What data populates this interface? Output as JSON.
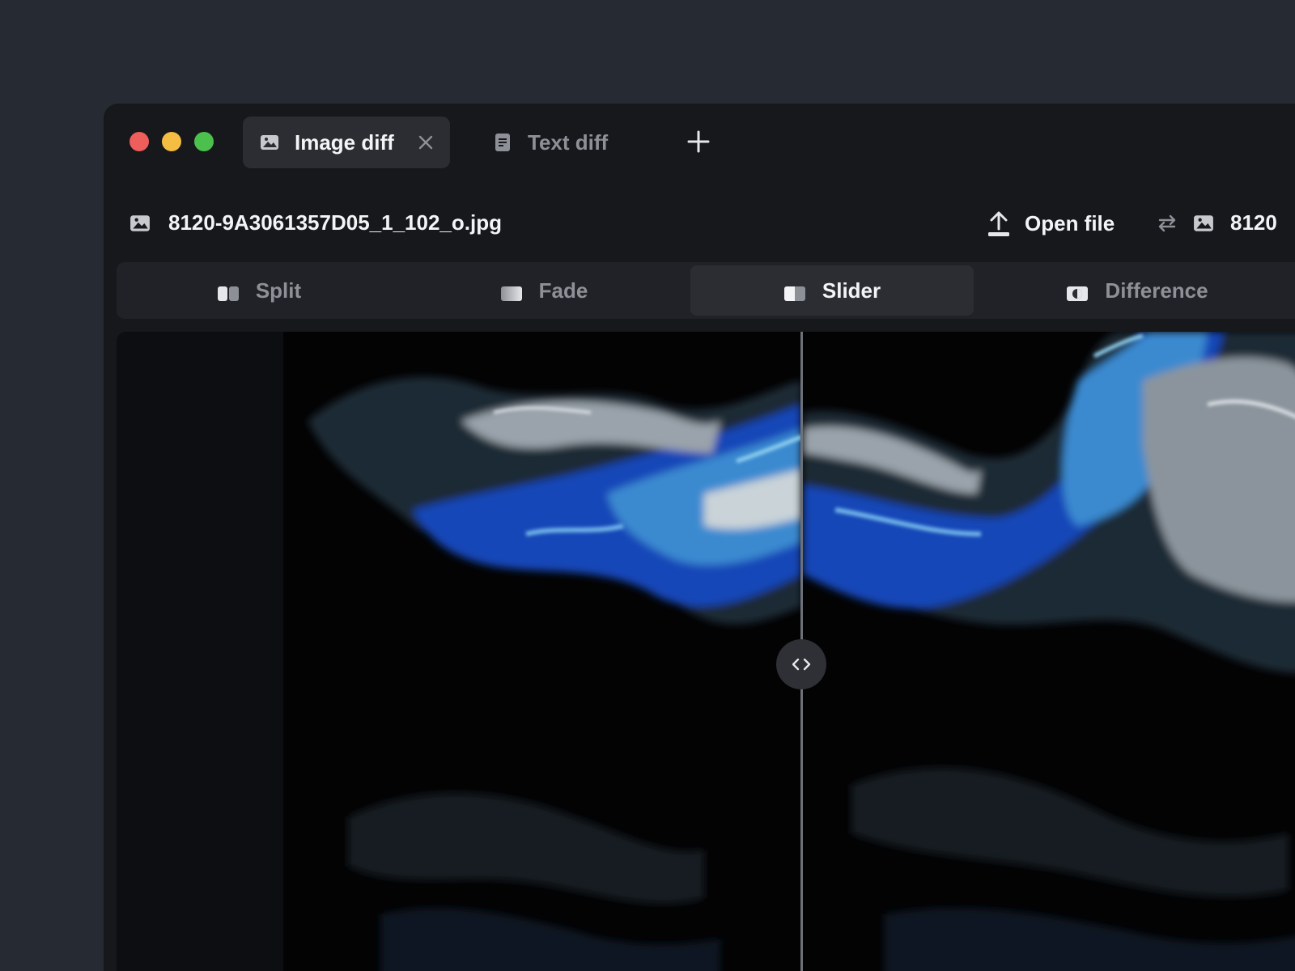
{
  "tabs": [
    {
      "label": "Image diff",
      "icon": "image-icon",
      "active": true
    },
    {
      "label": "Text diff",
      "icon": "document-icon",
      "active": false
    }
  ],
  "file": {
    "left_name": "8120-9A3061357D05_1_102_o.jpg",
    "open_label": "Open file",
    "right_name": "8120"
  },
  "modes": [
    {
      "label": "Split",
      "icon": "split-icon",
      "active": false
    },
    {
      "label": "Fade",
      "icon": "fade-icon",
      "active": false
    },
    {
      "label": "Slider",
      "icon": "slider-icon",
      "active": true
    },
    {
      "label": "Difference",
      "icon": "difference-icon",
      "active": false
    }
  ],
  "colors": {
    "background": "#262a33",
    "window": "#17181c",
    "accent_blue": "#2f6fe0",
    "traffic_red": "#ee5e5a",
    "traffic_yellow": "#f5bd41",
    "traffic_green": "#4cc04c"
  }
}
